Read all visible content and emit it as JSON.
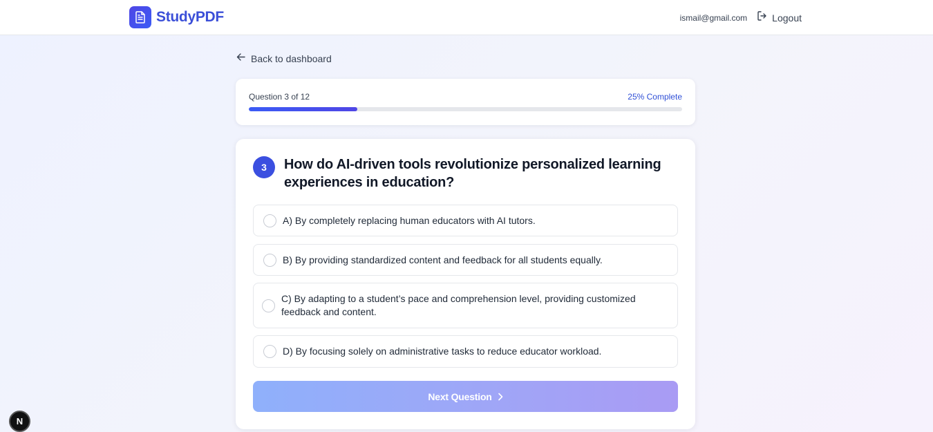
{
  "header": {
    "brand_name": "StudyPDF",
    "logo_icon": "document-icon",
    "user_email": "ismail@gmail.com",
    "logout_label": "Logout",
    "logout_icon": "logout-icon"
  },
  "navigation": {
    "back_label": "Back to dashboard",
    "back_icon": "arrow-left-icon"
  },
  "progress": {
    "label": "Question 3 of 12",
    "percent_label": "25% Complete",
    "fraction": 0.25
  },
  "question": {
    "number": "3",
    "text": "How do AI-driven tools revolutionize personalized learning experiences in education?",
    "options": [
      {
        "label": "A) By completely replacing human educators with AI tutors."
      },
      {
        "label": "B) By providing standardized content and feedback for all students equally."
      },
      {
        "label": "C) By adapting to a student’s pace and comprehension level, providing customized feedback and content."
      },
      {
        "label": "D) By focusing solely on administrative tasks to reduce educator workload."
      }
    ]
  },
  "actions": {
    "next_label": "Next Question",
    "next_icon": "chevron-right-icon"
  },
  "dev_badge": {
    "label": "N"
  },
  "colors": {
    "accent": "#3b4fe0",
    "progress_fill": "#4f46e5",
    "button_gradient_start": "#8fb0fb",
    "button_gradient_end": "#a99bf4"
  }
}
